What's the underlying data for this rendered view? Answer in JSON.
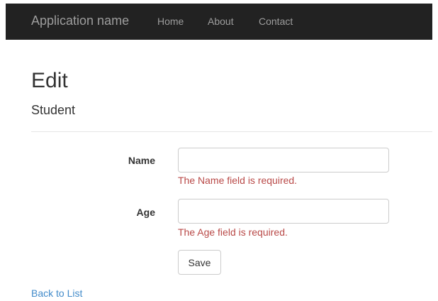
{
  "navbar": {
    "brand": "Application name",
    "links": [
      {
        "label": "Home"
      },
      {
        "label": "About"
      },
      {
        "label": "Contact"
      }
    ],
    "background_color": "#222222",
    "link_color": "#9d9d9d"
  },
  "page": {
    "title": "Edit",
    "subtitle": "Student"
  },
  "form": {
    "fields": [
      {
        "label": "Name",
        "value": "",
        "placeholder": "",
        "error": "The Name field is required."
      },
      {
        "label": "Age",
        "value": "",
        "placeholder": "",
        "error": "The Age field is required."
      }
    ],
    "save_label": "Save",
    "error_color": "#b94a48"
  },
  "footer_link": {
    "label": "Back to List",
    "color": "#428bca"
  }
}
